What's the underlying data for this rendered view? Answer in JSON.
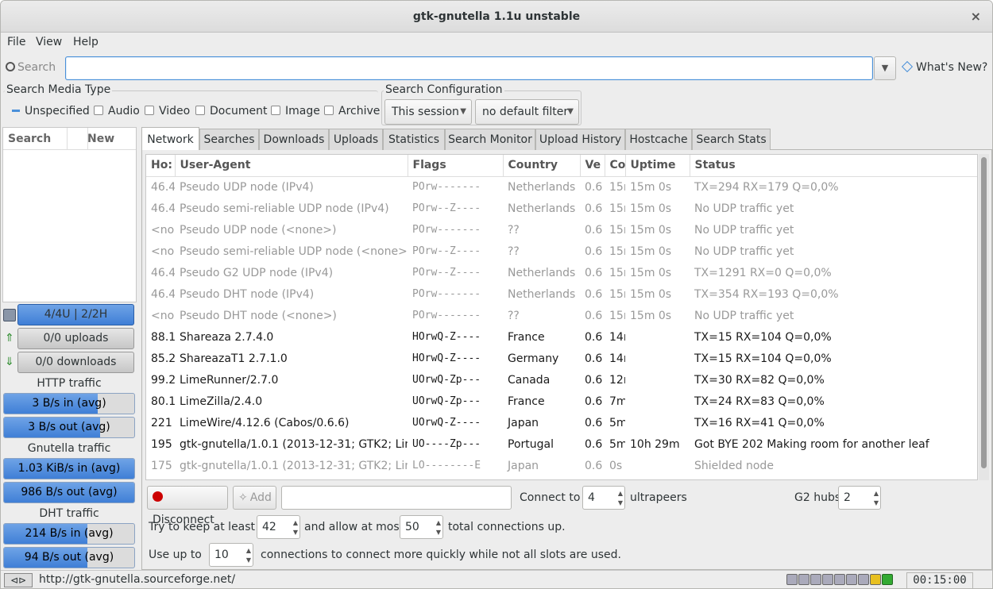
{
  "window": {
    "title": "gtk-gnutella 1.1u unstable",
    "close_glyph": "×"
  },
  "menubar": {
    "items": [
      "File",
      "View",
      "Help"
    ]
  },
  "search": {
    "label": "Search",
    "value": "",
    "whats_new": "What's New?"
  },
  "media_type": {
    "title": "Search Media Type",
    "options": [
      {
        "label": "Unspecified",
        "state": "indeterminate"
      },
      {
        "label": "Audio",
        "state": "unchecked"
      },
      {
        "label": "Video",
        "state": "unchecked"
      },
      {
        "label": "Document",
        "state": "unchecked"
      },
      {
        "label": "Image",
        "state": "unchecked"
      },
      {
        "label": "Archive",
        "state": "unchecked"
      }
    ]
  },
  "search_config": {
    "title": "Search Configuration",
    "session": "This session",
    "filter": "no default filter"
  },
  "left_panel": {
    "headers": [
      "Search",
      "New"
    ],
    "connections_button": "4/4U | 2/2H",
    "uploads_button": "0/0 uploads",
    "downloads_button": "0/0 downloads",
    "http_label": "HTTP traffic",
    "http_in": {
      "text": "3 B/s in (avg)",
      "fill": 0.72
    },
    "http_out": {
      "text": "3 B/s out (avg)",
      "fill": 0.74
    },
    "gnutella_label": "Gnutella traffic",
    "gnutella_in": {
      "text": "1.03 KiB/s in (avg)",
      "fill": 1.0
    },
    "gnutella_out": {
      "text": "986 B/s out (avg)",
      "fill": 1.0
    },
    "dht_label": "DHT traffic",
    "dht_in": {
      "text": "214 B/s in (avg)",
      "fill": 0.64
    },
    "dht_out": {
      "text": "94 B/s out (avg)",
      "fill": 0.64
    }
  },
  "tabs": [
    "Network",
    "Searches",
    "Downloads",
    "Uploads",
    "Statistics",
    "Search Monitor",
    "Upload History",
    "Hostcache",
    "Search Stats"
  ],
  "active_tab": "Network",
  "grid": {
    "columns": [
      "Ho:",
      "User-Agent",
      "Flags",
      "Country",
      "Ve",
      "Co",
      "Uptime",
      "Status"
    ],
    "rows": [
      {
        "dim": true,
        "cells": [
          "46.4",
          "Pseudo UDP node (IPv4)",
          "POrw-------",
          "Netherlands",
          "0.6",
          "15r",
          "15m 0s",
          "TX=294 RX=179 Q=0,0%"
        ]
      },
      {
        "dim": true,
        "cells": [
          "46.4",
          "Pseudo semi-reliable UDP node (IPv4)",
          "POrw--Z----",
          "Netherlands",
          "0.6",
          "15r",
          "15m 0s",
          "No UDP traffic yet"
        ]
      },
      {
        "dim": true,
        "cells": [
          "<non",
          "Pseudo UDP node (<none>)",
          "POrw-------",
          "??",
          "0.6",
          "15r",
          "15m 0s",
          "No UDP traffic yet"
        ]
      },
      {
        "dim": true,
        "cells": [
          "<non",
          "Pseudo semi-reliable UDP node (<none>)",
          "POrw--Z----",
          "??",
          "0.6",
          "15r",
          "15m 0s",
          "No UDP traffic yet"
        ]
      },
      {
        "dim": true,
        "cells": [
          "46.4",
          "Pseudo G2 UDP node (IPv4)",
          "POrw--Z----",
          "Netherlands",
          "0.6",
          "15r",
          "15m 0s",
          "TX=1291 RX=0 Q=0,0%"
        ]
      },
      {
        "dim": true,
        "cells": [
          "46.4",
          "Pseudo DHT node (IPv4)",
          "POrw-------",
          "Netherlands",
          "0.6",
          "15r",
          "15m 0s",
          "TX=354 RX=193 Q=0,0%"
        ]
      },
      {
        "dim": true,
        "cells": [
          "<non",
          "Pseudo DHT node (<none>)",
          "POrw-------",
          "??",
          "0.6",
          "15r",
          "15m 0s",
          "No UDP traffic yet"
        ]
      },
      {
        "dim": false,
        "cells": [
          "88.1",
          "Shareaza 2.7.4.0",
          "HOrwQ-Z----",
          "France",
          "0.6",
          "14r",
          "",
          "TX=15 RX=104 Q=0,0%"
        ]
      },
      {
        "dim": false,
        "cells": [
          "85.2",
          "ShareazaT1 2.7.1.0",
          "HOrwQ-Z----",
          "Germany",
          "0.6",
          "14r",
          "",
          "TX=15 RX=104 Q=0,0%"
        ]
      },
      {
        "dim": false,
        "cells": [
          "99.2",
          "LimeRunner/2.7.0",
          "UOrwQ-Zp---",
          "Canada",
          "0.6",
          "12r",
          "",
          "TX=30 RX=82 Q=0,0%"
        ]
      },
      {
        "dim": false,
        "cells": [
          "80.1",
          "LimeZilla/2.4.0",
          "UOrwQ-Zp---",
          "France",
          "0.6",
          "7m",
          "",
          "TX=24 RX=83 Q=0,0%"
        ]
      },
      {
        "dim": false,
        "cells": [
          "221",
          "LimeWire/4.12.6 (Cabos/0.6.6)",
          "UOrwQ-Z----",
          "Japan",
          "0.6",
          "5m",
          "",
          "TX=16 RX=41 Q=0,0%"
        ]
      },
      {
        "dim": false,
        "cells": [
          "195",
          "gtk-gnutella/1.0.1 (2013-12-31; GTK2; Lin",
          "UO----Zp---",
          "Portugal",
          "0.6",
          "5m",
          "10h 29m",
          "Got BYE 202 Making room for another leaf"
        ]
      },
      {
        "dim": true,
        "cells": [
          "175",
          "gtk-gnutella/1.0.1 (2013-12-31; GTK2; Lin",
          "LO--------E",
          "Japan",
          "0.6",
          "0s",
          "",
          "Shielded node"
        ]
      }
    ]
  },
  "controls": {
    "disconnect": "Disconnect",
    "add": "Add",
    "connect_to_label": "Connect to",
    "connect_to_value": "4",
    "ultrapeers_label": "ultrapeers",
    "g2_hubs_label": "G2 hubs",
    "g2_hubs_value": "2",
    "keep_label": "Try to keep at least",
    "keep_value": "42",
    "allow_label": "and allow at most",
    "allow_value": "50",
    "total_label": "total connections up.",
    "useup_label": "Use up to",
    "useup_value": "10",
    "useup_suffix": "connections to connect more quickly while not all slots are used."
  },
  "statusbar": {
    "url": "http://gtk-gnutella.sourceforge.net/",
    "time": "00:15:00"
  },
  "colors": {
    "accent": "#4a90d9",
    "bar_fill": "#3f7fd6",
    "disconnect_dot": "#cc0000"
  }
}
